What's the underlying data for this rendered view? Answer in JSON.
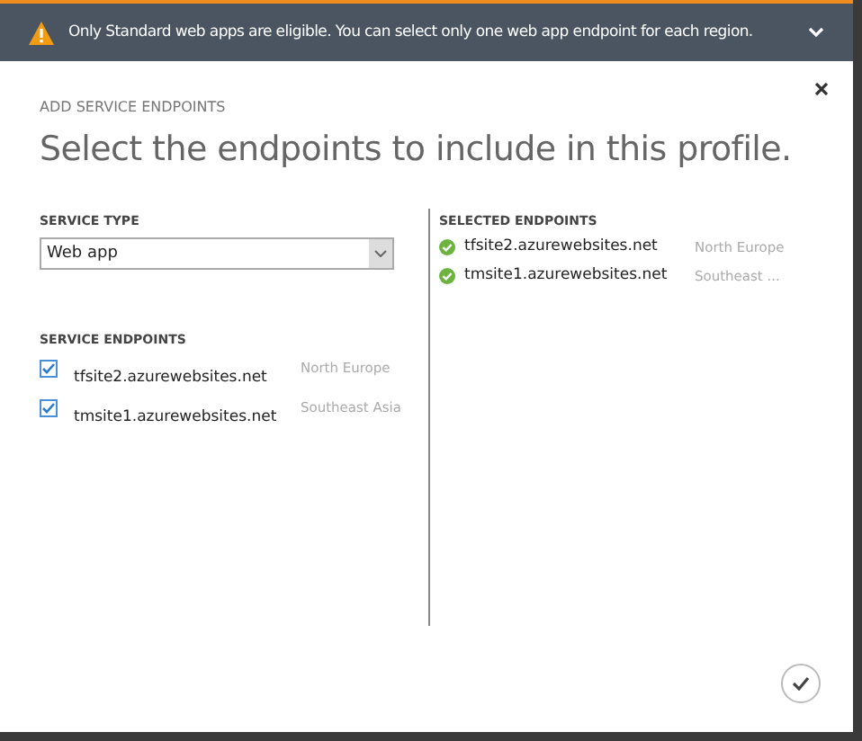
{
  "banner": {
    "message": "Only Standard web apps are eligible. You can select only one web app endpoint for each region."
  },
  "dialog": {
    "subtitle": "ADD SERVICE ENDPOINTS",
    "title": "Select the endpoints to include in this profile."
  },
  "service_type": {
    "label": "SERVICE TYPE",
    "value": "Web app"
  },
  "service_endpoints": {
    "label": "SERVICE ENDPOINTS",
    "items": [
      {
        "name": "tfsite2.azurewebsites.net",
        "region": "North Europe",
        "checked": true
      },
      {
        "name": "tmsite1.azurewebsites.net",
        "region": "Southeast Asia",
        "checked": true
      }
    ]
  },
  "selected_endpoints": {
    "label": "SELECTED ENDPOINTS",
    "items": [
      {
        "name": "tfsite2.azurewebsites.net",
        "region": "North Europe"
      },
      {
        "name": "tmsite1.azurewebsites.net",
        "region": "Southeast ..."
      }
    ]
  }
}
